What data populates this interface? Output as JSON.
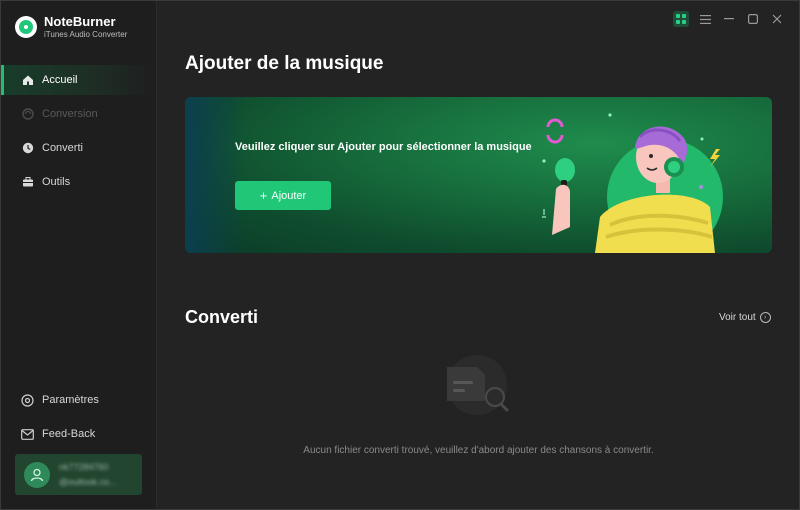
{
  "app": {
    "name": "NoteBurner",
    "subtitle": "iTunes Audio Converter"
  },
  "sidebar": {
    "items": [
      {
        "label": "Accueil",
        "icon": "home-icon",
        "state": "active"
      },
      {
        "label": "Conversion",
        "icon": "conversion-icon",
        "state": "disabled"
      },
      {
        "label": "Converti",
        "icon": "clock-icon",
        "state": "normal"
      },
      {
        "label": "Outils",
        "icon": "toolbox-icon",
        "state": "normal"
      }
    ],
    "bottom_items": [
      {
        "label": "Paramètres",
        "icon": "settings-icon"
      },
      {
        "label": "Feed-Back",
        "icon": "mail-icon"
      }
    ],
    "account": {
      "line1": "nk77284760",
      "line2": "@outlook.co..."
    }
  },
  "titlebar": {
    "icons": [
      "apps-grid-icon",
      "menu-icon",
      "minimize-icon",
      "maximize-icon",
      "close-icon"
    ]
  },
  "main": {
    "title": "Ajouter de la musique",
    "banner": {
      "message": "Veuillez cliquer sur Ajouter pour sélectionner la musique",
      "button_label": "Ajouter",
      "button_icon": "plus-icon"
    },
    "converted": {
      "title": "Converti",
      "see_all": "Voir tout",
      "empty_message": "Aucun fichier converti trouvé, veuillez d'abord ajouter des chansons à convertir."
    }
  },
  "colors": {
    "accent": "#1fc777",
    "banner_green": "#176f3d",
    "sidebar_bg": "#1e1e1e",
    "main_bg": "#232323"
  }
}
